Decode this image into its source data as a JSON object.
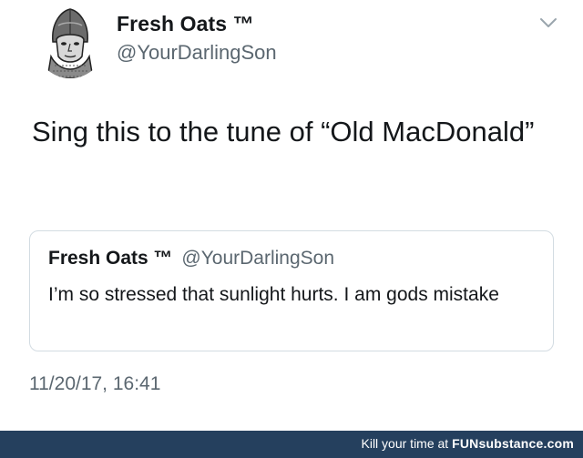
{
  "tweet": {
    "display_name": "Fresh Oats ™",
    "handle": "@YourDarlingSon",
    "text": "Sing this to the tune of “Old MacDonald”",
    "timestamp": "11/20/17, 16:41",
    "menu_icon": "chevron-down-icon",
    "avatar_icon": "knight-helmet-avatar"
  },
  "quoted_tweet": {
    "display_name": "Fresh Oats ™",
    "handle": "@YourDarlingSon",
    "text": "I’m so stressed that sunlight hurts. I am gods mistake"
  },
  "watermark": {
    "prefix": "Kill your time at ",
    "brand": "FUNsubstance.com",
    "background_color": "#25405e"
  }
}
